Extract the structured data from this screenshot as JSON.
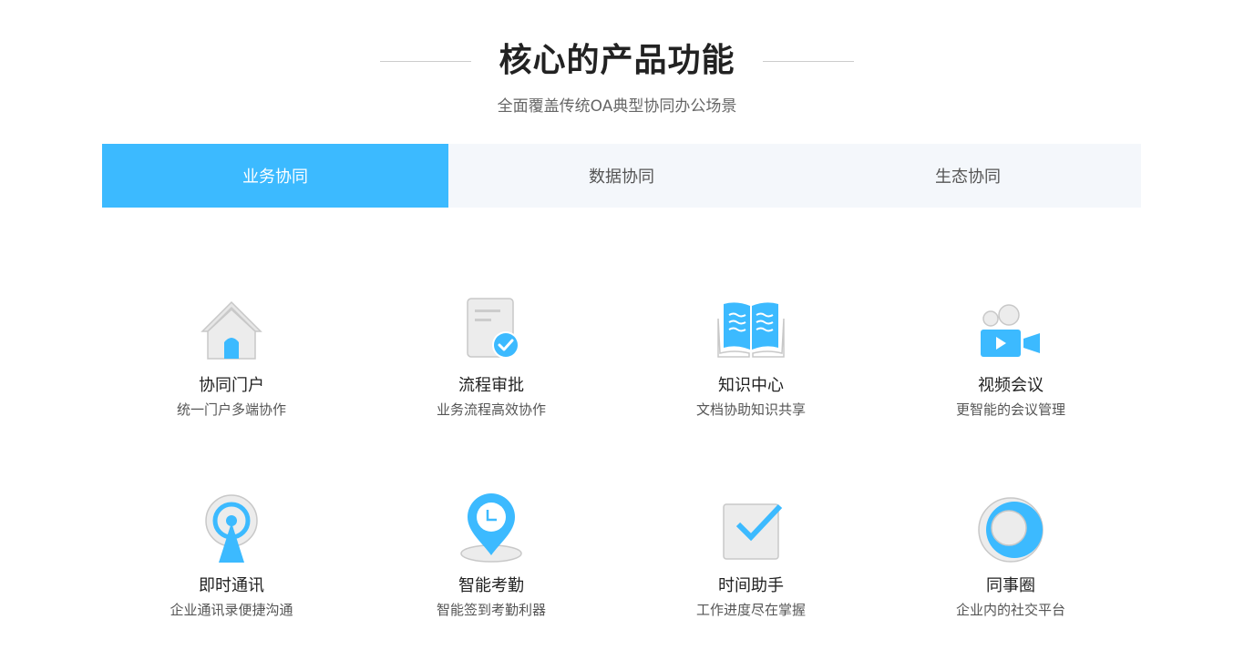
{
  "section": {
    "title": "核心的产品功能",
    "subtitle": "全面覆盖传统OA典型协同办公场景"
  },
  "tabs": [
    {
      "label": "业务协同",
      "active": true
    },
    {
      "label": "数据协同",
      "active": false
    },
    {
      "label": "生态协同",
      "active": false
    }
  ],
  "features": [
    {
      "name": "协同门户",
      "desc": "统一门户多端协作",
      "icon": "home-icon"
    },
    {
      "name": "流程审批",
      "desc": "业务流程高效协作",
      "icon": "document-check-icon"
    },
    {
      "name": "知识中心",
      "desc": "文档协助知识共享",
      "icon": "open-book-icon"
    },
    {
      "name": "视频会议",
      "desc": "更智能的会议管理",
      "icon": "video-camera-icon"
    },
    {
      "name": "即时通讯",
      "desc": "企业通讯录便捷沟通",
      "icon": "signal-tower-icon"
    },
    {
      "name": "智能考勤",
      "desc": "智能签到考勤利器",
      "icon": "location-clock-icon"
    },
    {
      "name": "时间助手",
      "desc": "工作进度尽在掌握",
      "icon": "checkbox-icon"
    },
    {
      "name": "同事圈",
      "desc": "企业内的社交平台",
      "icon": "circle-ring-icon"
    }
  ],
  "colors": {
    "accent": "#3cbaff",
    "tab_bg": "#f4f7fb",
    "icon_gray": "#e8e8e8",
    "icon_stroke": "#cccccc"
  }
}
